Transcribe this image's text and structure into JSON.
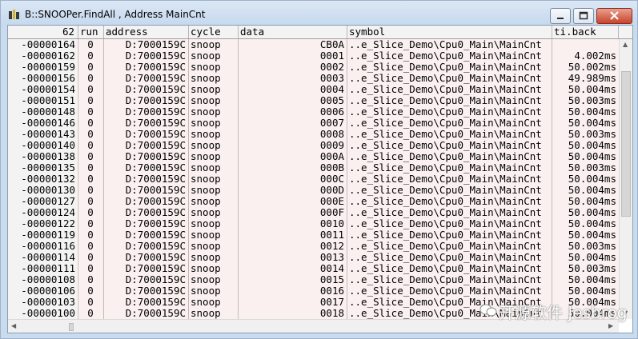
{
  "window": {
    "title": "B::SNOOPer.FindAll , Address MainCnt"
  },
  "columns": [
    {
      "key": "record",
      "label": "62"
    },
    {
      "key": "run",
      "label": "run"
    },
    {
      "key": "address",
      "label": "address"
    },
    {
      "key": "cycle",
      "label": "cycle"
    },
    {
      "key": "data",
      "label": "data"
    },
    {
      "key": "symbol",
      "label": "symbol"
    },
    {
      "key": "ti_back",
      "label": "ti.back"
    }
  ],
  "rows": [
    {
      "record": "-00000164",
      "run": "0",
      "address": "D:7000159C",
      "cycle": "snoop",
      "data": "CB0A",
      "symbol": "..e_Slice_Demo\\Cpu0_Main\\MainCnt",
      "ti_back": ""
    },
    {
      "record": "-00000162",
      "run": "0",
      "address": "D:7000159C",
      "cycle": "snoop",
      "data": "0001",
      "symbol": "..e_Slice_Demo\\Cpu0_Main\\MainCnt",
      "ti_back": "4.002ms"
    },
    {
      "record": "-00000159",
      "run": "0",
      "address": "D:7000159C",
      "cycle": "snoop",
      "data": "0002",
      "symbol": "..e_Slice_Demo\\Cpu0_Main\\MainCnt",
      "ti_back": "50.002ms"
    },
    {
      "record": "-00000156",
      "run": "0",
      "address": "D:7000159C",
      "cycle": "snoop",
      "data": "0003",
      "symbol": "..e_Slice_Demo\\Cpu0_Main\\MainCnt",
      "ti_back": "49.989ms"
    },
    {
      "record": "-00000154",
      "run": "0",
      "address": "D:7000159C",
      "cycle": "snoop",
      "data": "0004",
      "symbol": "..e_Slice_Demo\\Cpu0_Main\\MainCnt",
      "ti_back": "50.004ms"
    },
    {
      "record": "-00000151",
      "run": "0",
      "address": "D:7000159C",
      "cycle": "snoop",
      "data": "0005",
      "symbol": "..e_Slice_Demo\\Cpu0_Main\\MainCnt",
      "ti_back": "50.003ms"
    },
    {
      "record": "-00000148",
      "run": "0",
      "address": "D:7000159C",
      "cycle": "snoop",
      "data": "0006",
      "symbol": "..e_Slice_Demo\\Cpu0_Main\\MainCnt",
      "ti_back": "50.004ms"
    },
    {
      "record": "-00000146",
      "run": "0",
      "address": "D:7000159C",
      "cycle": "snoop",
      "data": "0007",
      "symbol": "..e_Slice_Demo\\Cpu0_Main\\MainCnt",
      "ti_back": "50.004ms"
    },
    {
      "record": "-00000143",
      "run": "0",
      "address": "D:7000159C",
      "cycle": "snoop",
      "data": "0008",
      "symbol": "..e_Slice_Demo\\Cpu0_Main\\MainCnt",
      "ti_back": "50.003ms"
    },
    {
      "record": "-00000140",
      "run": "0",
      "address": "D:7000159C",
      "cycle": "snoop",
      "data": "0009",
      "symbol": "..e_Slice_Demo\\Cpu0_Main\\MainCnt",
      "ti_back": "50.004ms"
    },
    {
      "record": "-00000138",
      "run": "0",
      "address": "D:7000159C",
      "cycle": "snoop",
      "data": "000A",
      "symbol": "..e_Slice_Demo\\Cpu0_Main\\MainCnt",
      "ti_back": "50.004ms"
    },
    {
      "record": "-00000135",
      "run": "0",
      "address": "D:7000159C",
      "cycle": "snoop",
      "data": "000B",
      "symbol": "..e_Slice_Demo\\Cpu0_Main\\MainCnt",
      "ti_back": "50.003ms"
    },
    {
      "record": "-00000132",
      "run": "0",
      "address": "D:7000159C",
      "cycle": "snoop",
      "data": "000C",
      "symbol": "..e_Slice_Demo\\Cpu0_Main\\MainCnt",
      "ti_back": "50.004ms"
    },
    {
      "record": "-00000130",
      "run": "0",
      "address": "D:7000159C",
      "cycle": "snoop",
      "data": "000D",
      "symbol": "..e_Slice_Demo\\Cpu0_Main\\MainCnt",
      "ti_back": "50.004ms"
    },
    {
      "record": "-00000127",
      "run": "0",
      "address": "D:7000159C",
      "cycle": "snoop",
      "data": "000E",
      "symbol": "..e_Slice_Demo\\Cpu0_Main\\MainCnt",
      "ti_back": "50.004ms"
    },
    {
      "record": "-00000124",
      "run": "0",
      "address": "D:7000159C",
      "cycle": "snoop",
      "data": "000F",
      "symbol": "..e_Slice_Demo\\Cpu0_Main\\MainCnt",
      "ti_back": "50.004ms"
    },
    {
      "record": "-00000122",
      "run": "0",
      "address": "D:7000159C",
      "cycle": "snoop",
      "data": "0010",
      "symbol": "..e_Slice_Demo\\Cpu0_Main\\MainCnt",
      "ti_back": "50.004ms"
    },
    {
      "record": "-00000119",
      "run": "0",
      "address": "D:7000159C",
      "cycle": "snoop",
      "data": "0011",
      "symbol": "..e_Slice_Demo\\Cpu0_Main\\MainCnt",
      "ti_back": "50.004ms"
    },
    {
      "record": "-00000116",
      "run": "0",
      "address": "D:7000159C",
      "cycle": "snoop",
      "data": "0012",
      "symbol": "..e_Slice_Demo\\Cpu0_Main\\MainCnt",
      "ti_back": "50.003ms"
    },
    {
      "record": "-00000114",
      "run": "0",
      "address": "D:7000159C",
      "cycle": "snoop",
      "data": "0013",
      "symbol": "..e_Slice_Demo\\Cpu0_Main\\MainCnt",
      "ti_back": "50.004ms"
    },
    {
      "record": "-00000111",
      "run": "0",
      "address": "D:7000159C",
      "cycle": "snoop",
      "data": "0014",
      "symbol": "..e_Slice_Demo\\Cpu0_Main\\MainCnt",
      "ti_back": "50.003ms"
    },
    {
      "record": "-00000108",
      "run": "0",
      "address": "D:7000159C",
      "cycle": "snoop",
      "data": "0015",
      "symbol": "..e_Slice_Demo\\Cpu0_Main\\MainCnt",
      "ti_back": "50.004ms"
    },
    {
      "record": "-00000106",
      "run": "0",
      "address": "D:7000159C",
      "cycle": "snoop",
      "data": "0016",
      "symbol": "..e_Slice_Demo\\Cpu0_Main\\MainCnt",
      "ti_back": "50.004ms"
    },
    {
      "record": "-00000103",
      "run": "0",
      "address": "D:7000159C",
      "cycle": "snoop",
      "data": "0017",
      "symbol": "..e_Slice_Demo\\Cpu0_Main\\MainCnt",
      "ti_back": "50.004ms"
    },
    {
      "record": "-00000100",
      "run": "0",
      "address": "D:7000159C",
      "cycle": "snoop",
      "data": "0018",
      "symbol": "..e_Slice_Demo\\Cpu0_Main\\MainCnt",
      "ti_back": "50.004ms"
    }
  ],
  "watermark": {
    "text": "开源软件 Jesbrog"
  },
  "colors": {
    "row_tint": "#fbf0f0",
    "run_color": "#000000",
    "header_bg": "#f3f3f3"
  }
}
